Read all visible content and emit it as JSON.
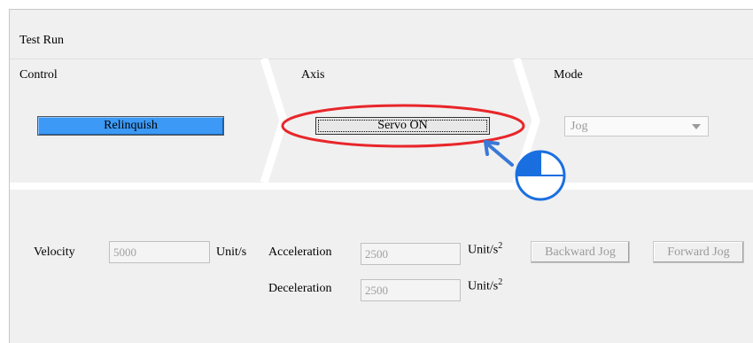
{
  "panel": {
    "title": "Test Run"
  },
  "control": {
    "label": "Control",
    "button": "Relinquish",
    "button_color": "#3c99f5"
  },
  "axis": {
    "label": "Axis",
    "button": "Servo ON",
    "highlight_color": "#e8262a"
  },
  "mode": {
    "label": "Mode",
    "selected": "Jog"
  },
  "jog": {
    "velocity_label": "Velocity",
    "velocity_value": "5000",
    "velocity_unit": "Unit/s",
    "acceleration_label": "Acceleration",
    "acceleration_value": "2500",
    "deceleration_label": "Deceleration",
    "deceleration_value": "2500",
    "accel_unit_base": "Unit/s",
    "accel_unit_exp": "2",
    "backward_button": "Backward Jog",
    "forward_button": "Forward Jog"
  },
  "callout": {
    "icon": "step-progress-pie-icon",
    "color": "#1a6fe0",
    "arrow_color": "#3a78d8"
  }
}
